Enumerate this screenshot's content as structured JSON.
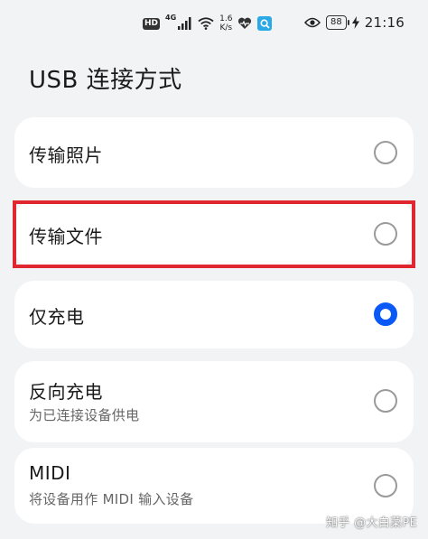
{
  "status_bar": {
    "hd": "HD",
    "network_type": "4G",
    "speed_value": "1.6",
    "speed_unit": "K/s",
    "battery": "88",
    "time": "21:16"
  },
  "page": {
    "title": "USB 连接方式"
  },
  "options": [
    {
      "label": "传输照片",
      "sublabel": "",
      "selected": false
    },
    {
      "label": "传输文件",
      "sublabel": "",
      "selected": false
    },
    {
      "label": "仅充电",
      "sublabel": "",
      "selected": true
    },
    {
      "label": "反向充电",
      "sublabel": "为已连接设备供电",
      "selected": false
    },
    {
      "label": "MIDI",
      "sublabel": "将设备用作 MIDI 输入设备",
      "selected": false
    }
  ],
  "watermark": "知乎 @大白菜PE",
  "colors": {
    "accent": "#0a59f7",
    "highlight": "#e0262e",
    "background": "#f1f3f5",
    "card": "#ffffff"
  }
}
